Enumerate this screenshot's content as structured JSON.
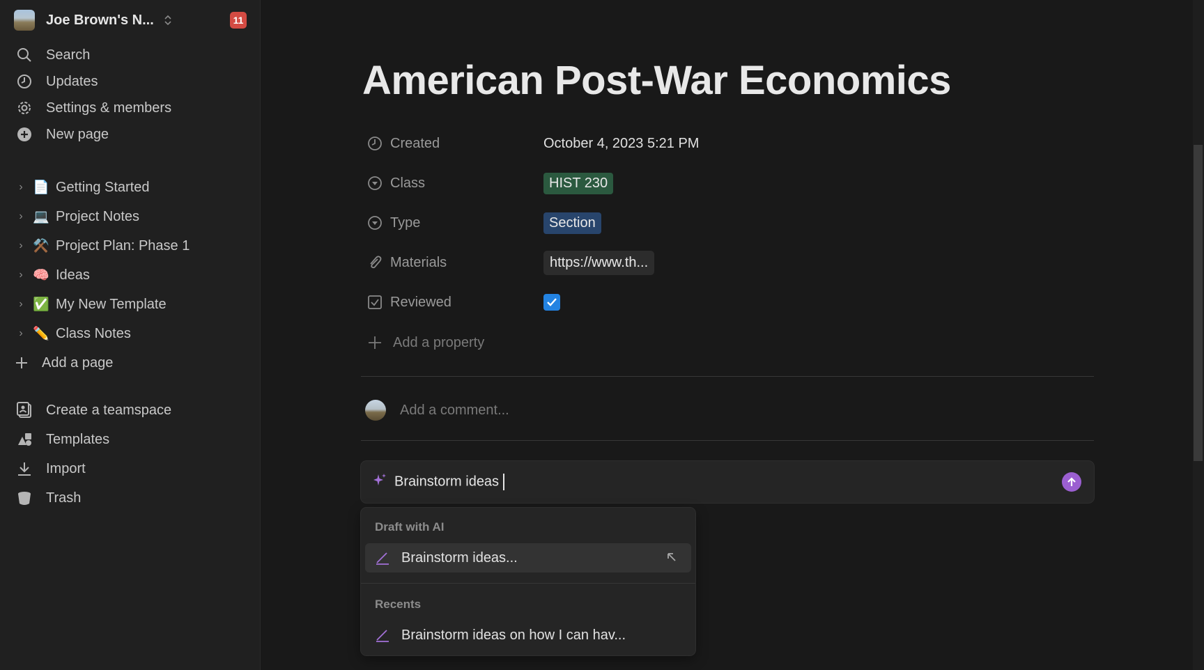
{
  "sidebar": {
    "workspace": {
      "name": "Joe Brown's N...",
      "badge": "11"
    },
    "nav": [
      {
        "label": "Search",
        "icon": "search-icon"
      },
      {
        "label": "Updates",
        "icon": "clock-icon"
      },
      {
        "label": "Settings & members",
        "icon": "gear-icon"
      },
      {
        "label": "New page",
        "icon": "plus-circle-icon"
      }
    ],
    "pages": [
      {
        "label": "Getting Started",
        "emoji": "📄"
      },
      {
        "label": "Project Notes",
        "emoji": "💻"
      },
      {
        "label": "Project Plan: Phase 1",
        "emoji": "⚒️"
      },
      {
        "label": "Ideas",
        "emoji": "🧠"
      },
      {
        "label": "My New Template",
        "emoji": "✅"
      },
      {
        "label": "Class Notes",
        "emoji": "✏️"
      }
    ],
    "add_page": "Add a page",
    "bottom": [
      {
        "label": "Create a teamspace",
        "icon": "teamspace-icon"
      },
      {
        "label": "Templates",
        "icon": "templates-icon"
      },
      {
        "label": "Import",
        "icon": "download-icon"
      },
      {
        "label": "Trash",
        "icon": "trash-icon"
      }
    ]
  },
  "page": {
    "title": "American Post-War Economics",
    "properties": {
      "created": {
        "name": "Created",
        "value": "October 4, 2023 5:21 PM"
      },
      "class": {
        "name": "Class",
        "value": "HIST 230"
      },
      "type": {
        "name": "Type",
        "value": "Section"
      },
      "materials": {
        "name": "Materials",
        "value": "https://www.th..."
      },
      "reviewed": {
        "name": "Reviewed",
        "checked": true
      }
    },
    "add_property": "Add a property",
    "comment_placeholder": "Add a comment..."
  },
  "ai": {
    "input_value": "Brainstorm ideas",
    "dropdown": {
      "draft_heading": "Draft with AI",
      "draft_item": "Brainstorm ideas...",
      "recents_heading": "Recents",
      "recent_item": "Brainstorm ideas on how I can hav..."
    }
  },
  "colors": {
    "accent_purple": "#9b5fd1",
    "tag_green": "#2b593f",
    "tag_blue": "#28456c",
    "checkbox_blue": "#2383e2"
  }
}
